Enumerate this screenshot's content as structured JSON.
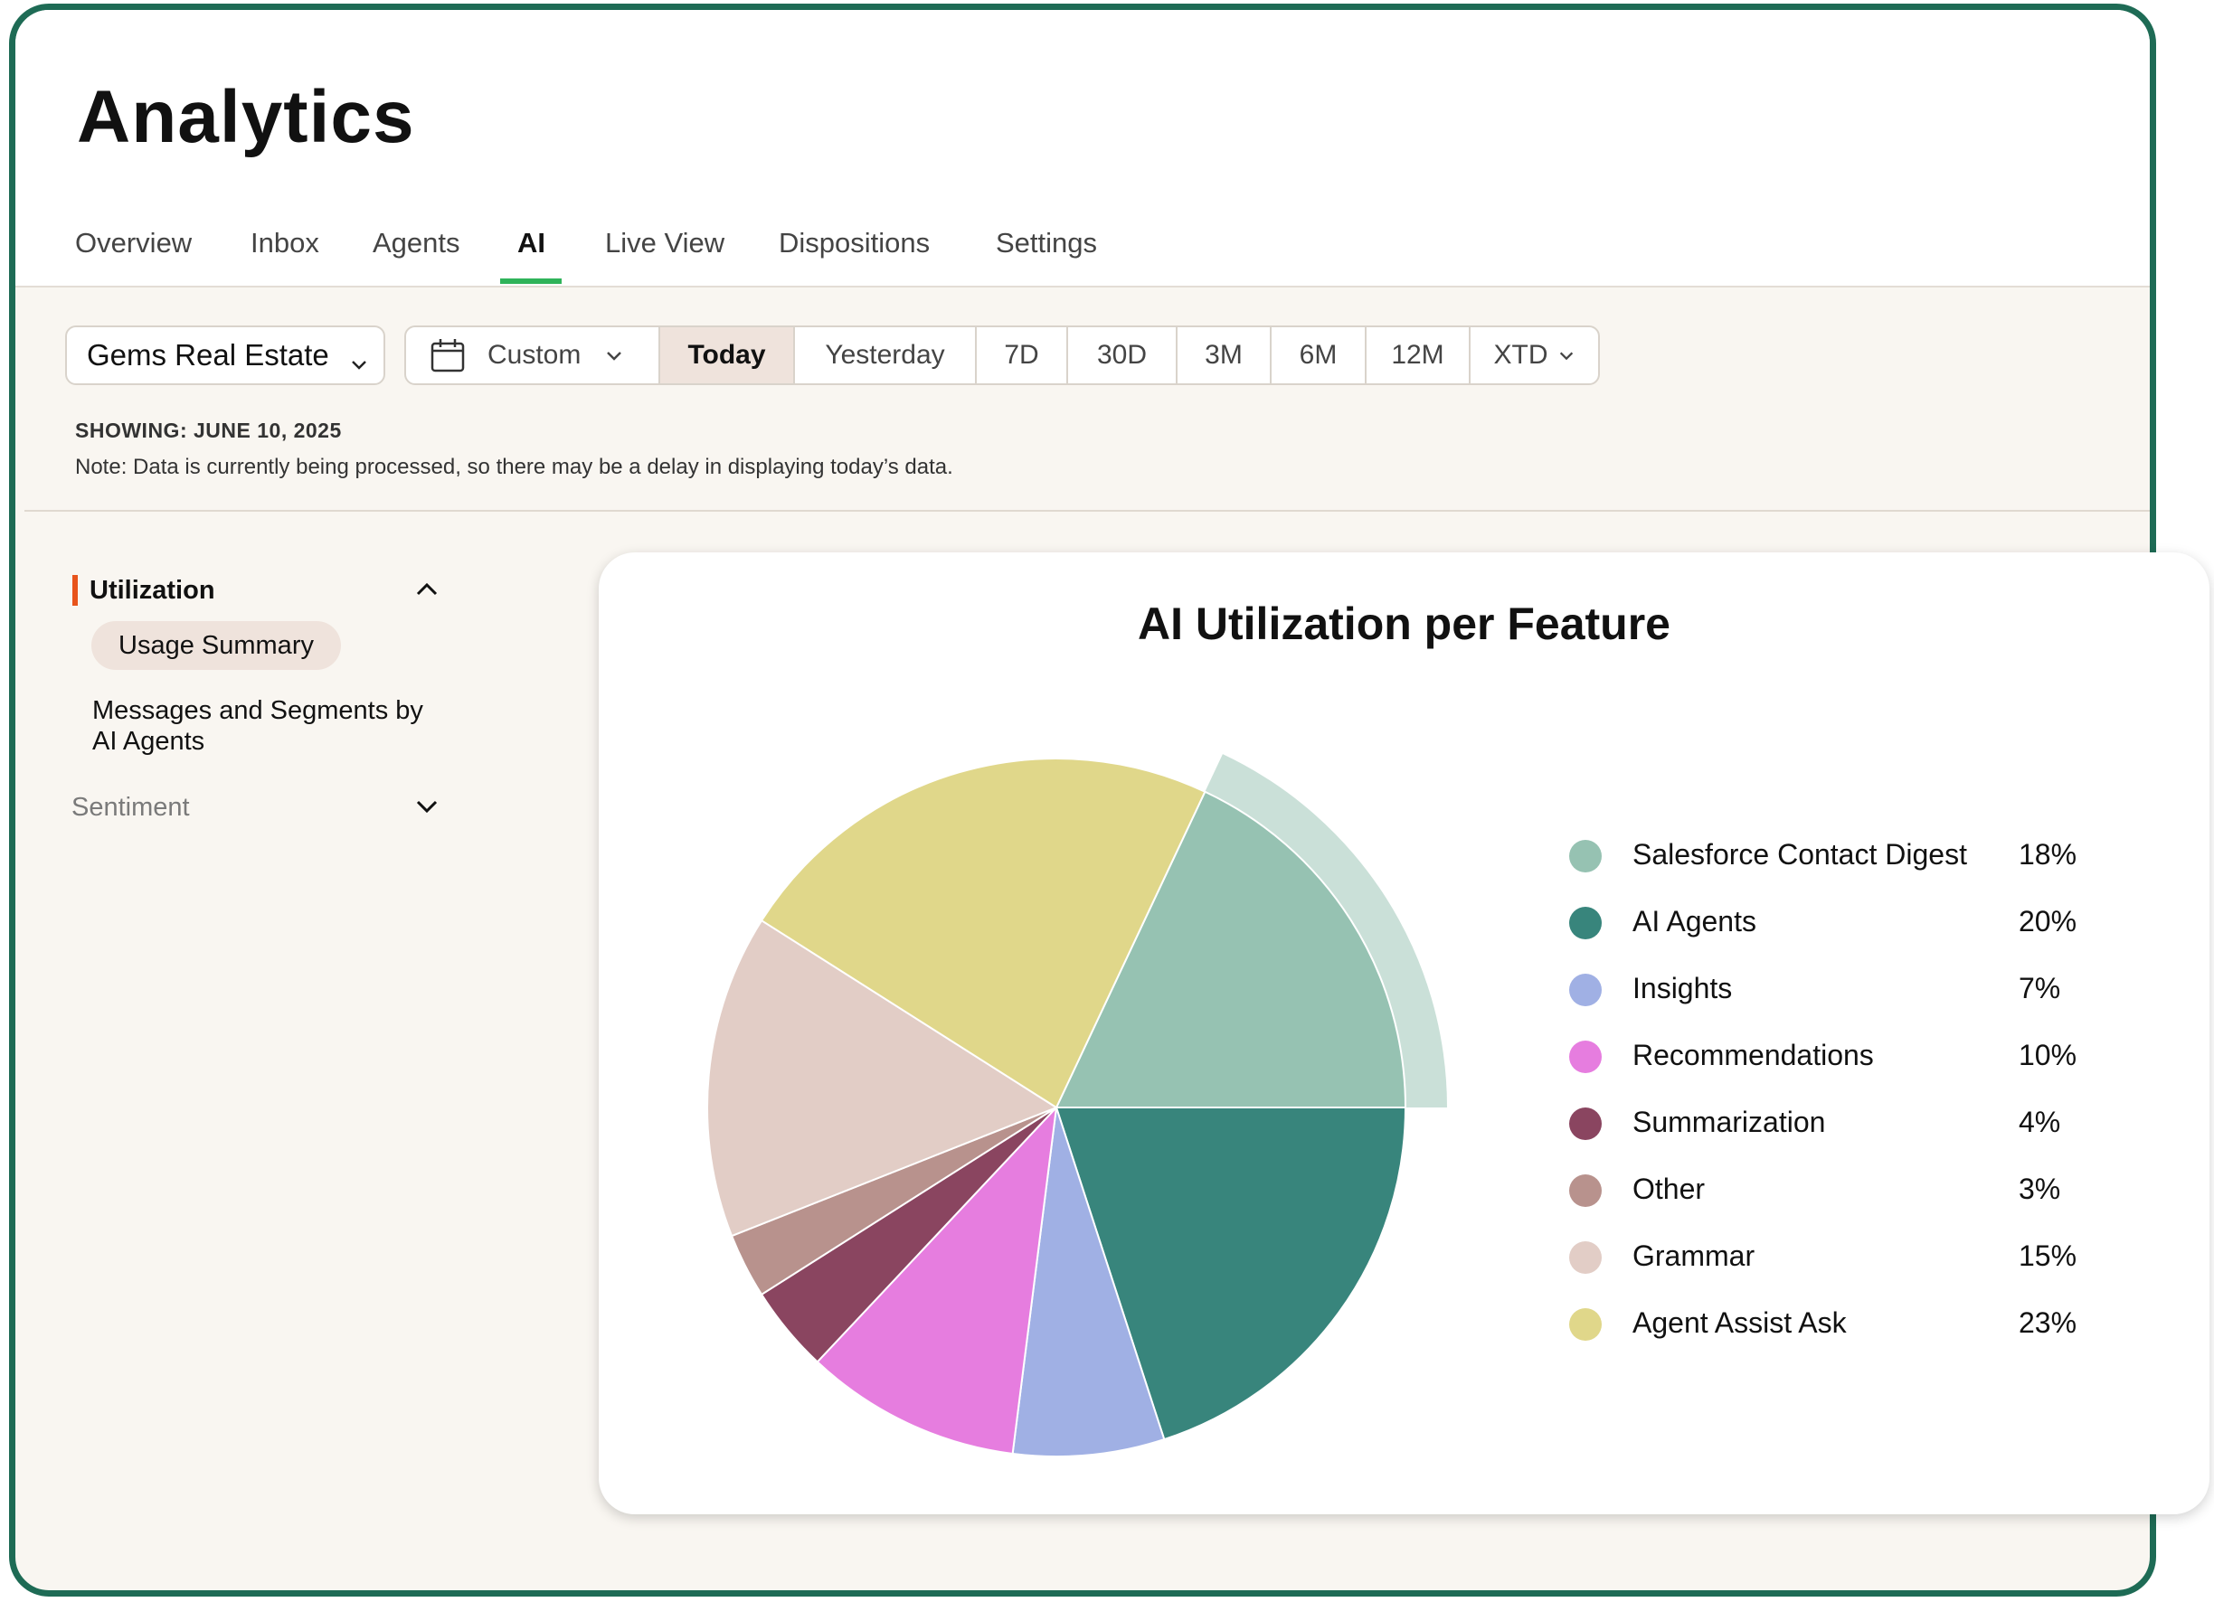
{
  "header": {
    "title": "Analytics"
  },
  "tabs": [
    {
      "label": "Overview"
    },
    {
      "label": "Inbox"
    },
    {
      "label": "Agents"
    },
    {
      "label": "AI",
      "active": true
    },
    {
      "label": "Live View"
    },
    {
      "label": "Dispositions"
    },
    {
      "label": "Settings"
    }
  ],
  "filters": {
    "account": "Gems Real Estate",
    "custom_label": "Custom",
    "ranges": [
      "Today",
      "Yesterday",
      "7D",
      "30D",
      "3M",
      "6M",
      "12M",
      "XTD"
    ],
    "selected_range": "Today"
  },
  "showing": "SHOWING:  JUNE 10, 2025",
  "note": "Note: Data is currently being processed, so there may be a delay in displaying today’s data.",
  "sidebar": {
    "utilization_label": "Utilization",
    "items": [
      "Usage Summary",
      "Messages and Segments by AI Agents"
    ],
    "sentiment_label": "Sentiment"
  },
  "chart_data": {
    "type": "pie",
    "title": "AI Utilization per Feature",
    "highlighted": "Salesforce Contact Digest",
    "slices": [
      {
        "label": "Salesforce Contact Digest",
        "value": 18,
        "display": "18%",
        "color": "#96c2b2"
      },
      {
        "label": "AI Agents",
        "value": 20,
        "display": "20%",
        "color": "#38857c"
      },
      {
        "label": "Insights",
        "value": 7,
        "display": "7%",
        "color": "#a0b0e4"
      },
      {
        "label": "Recommendations",
        "value": 10,
        "display": "10%",
        "color": "#e67ddf"
      },
      {
        "label": "Summarization",
        "value": 4,
        "display": "4%",
        "color": "#8a4560"
      },
      {
        "label": "Other",
        "value": 3,
        "display": "3%",
        "color": "#b8928d"
      },
      {
        "label": "Grammar",
        "value": 15,
        "display": "15%",
        "color": "#e2cdc6"
      },
      {
        "label": "Agent Assist Ask",
        "value": 23,
        "display": "23%",
        "color": "#e0d78a"
      }
    ]
  }
}
